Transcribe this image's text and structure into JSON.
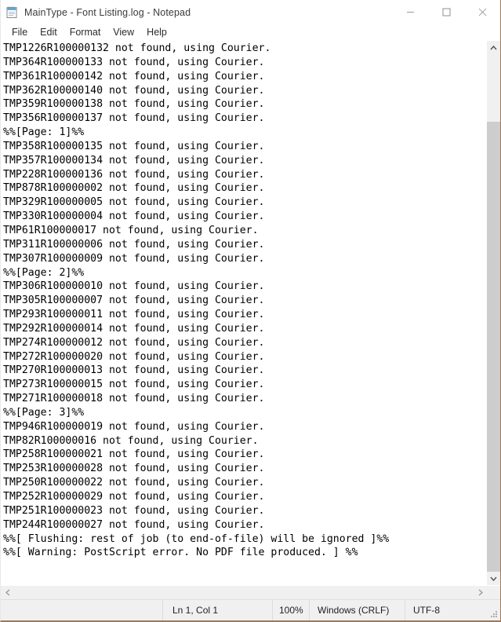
{
  "window": {
    "title": "MainType - Font Listing.log - Notepad",
    "icon": "notepad-icon",
    "controls": {
      "minimize": "minimize-icon",
      "maximize": "maximize-icon",
      "close": "close-icon"
    }
  },
  "menubar": {
    "items": [
      {
        "label": "File"
      },
      {
        "label": "Edit"
      },
      {
        "label": "Format"
      },
      {
        "label": "View"
      },
      {
        "label": "Help"
      }
    ]
  },
  "document": {
    "lines": [
      "TMP1226R100000132 not found, using Courier.",
      "TMP364R100000133 not found, using Courier.",
      "TMP361R100000142 not found, using Courier.",
      "TMP362R100000140 not found, using Courier.",
      "TMP359R100000138 not found, using Courier.",
      "TMP356R100000137 not found, using Courier.",
      "%%[Page: 1]%%",
      "TMP358R100000135 not found, using Courier.",
      "TMP357R100000134 not found, using Courier.",
      "TMP228R100000136 not found, using Courier.",
      "TMP878R100000002 not found, using Courier.",
      "TMP329R100000005 not found, using Courier.",
      "TMP330R100000004 not found, using Courier.",
      "TMP61R100000017 not found, using Courier.",
      "TMP311R100000006 not found, using Courier.",
      "TMP307R100000009 not found, using Courier.",
      "%%[Page: 2]%%",
      "TMP306R100000010 not found, using Courier.",
      "TMP305R100000007 not found, using Courier.",
      "TMP293R100000011 not found, using Courier.",
      "TMP292R100000014 not found, using Courier.",
      "TMP274R100000012 not found, using Courier.",
      "TMP272R100000020 not found, using Courier.",
      "TMP270R100000013 not found, using Courier.",
      "TMP273R100000015 not found, using Courier.",
      "TMP271R100000018 not found, using Courier.",
      "%%[Page: 3]%%",
      "TMP946R100000019 not found, using Courier.",
      "TMP82R100000016 not found, using Courier.",
      "TMP258R100000021 not found, using Courier.",
      "TMP253R100000028 not found, using Courier.",
      "TMP250R100000022 not found, using Courier.",
      "TMP252R100000029 not found, using Courier.",
      "TMP251R100000023 not found, using Courier.",
      "TMP244R100000027 not found, using Courier.",
      "%%[ Flushing: rest of job (to end-of-file) will be ignored ]%%",
      "%%[ Warning: PostScript error. No PDF file produced. ] %%"
    ]
  },
  "scrollbars": {
    "vertical": {
      "up_arrow": "chevron-up-icon",
      "down_arrow": "chevron-down-icon",
      "thumb_top_pct": 13,
      "thumb_height_pct": 87
    },
    "horizontal": {
      "left_arrow": "chevron-left-icon",
      "right_arrow": "chevron-right-icon"
    }
  },
  "statusbar": {
    "cursor_position": "Ln 1, Col 1",
    "zoom": "100%",
    "line_ending": "Windows (CRLF)",
    "encoding": "UTF-8"
  },
  "colors": {
    "window_bg": "#ffffff",
    "text": "#000000",
    "statusbar_bg": "#f0f0f0",
    "scrollbar_track": "#f0f0f0",
    "scrollbar_thumb": "#cdcdcd",
    "border": "#9b7a5e"
  }
}
